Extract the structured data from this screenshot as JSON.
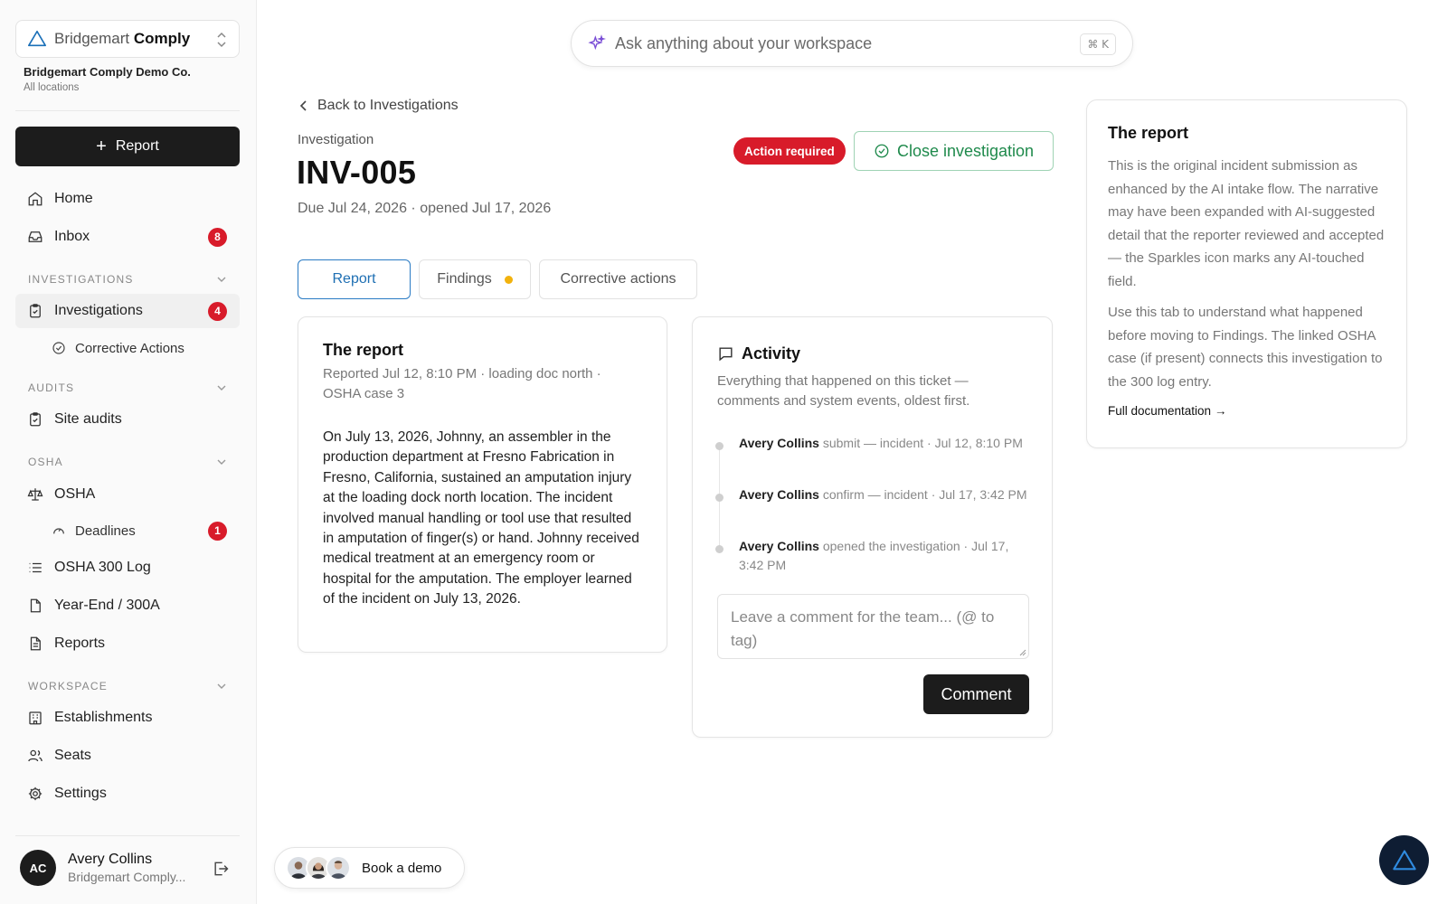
{
  "workspace": {
    "brand_light": "Bridgemart",
    "brand_bold": "Comply",
    "org_name": "Bridgemart Comply Demo Co.",
    "org_location": "All locations"
  },
  "sidebar": {
    "report_button": "Report",
    "home": "Home",
    "inbox": {
      "label": "Inbox",
      "badge": "8"
    },
    "sections": {
      "investigations": "INVESTIGATIONS",
      "audits": "AUDITS",
      "osha": "OSHA",
      "workspace": "WORKSPACE"
    },
    "investigations": {
      "label": "Investigations",
      "badge": "4"
    },
    "corrective_actions": "Corrective Actions",
    "site_audits": "Site audits",
    "osha": "OSHA",
    "deadlines": {
      "label": "Deadlines",
      "badge": "1"
    },
    "osha_300_log": "OSHA 300 Log",
    "year_end": "Year-End / 300A",
    "reports": "Reports",
    "establishments": "Establishments",
    "seats": "Seats",
    "settings": "Settings"
  },
  "user": {
    "initials": "AC",
    "name": "Avery Collins",
    "org": "Bridgemart Comply..."
  },
  "search": {
    "placeholder": "Ask anything about your workspace",
    "shortcut": "⌘ K"
  },
  "investigation": {
    "back_label": "Back to Investigations",
    "label": "Investigation",
    "id": "INV-005",
    "dates": "Due Jul 24, 2026 · opened Jul 17, 2026",
    "status": "Action required",
    "close_button": "Close investigation"
  },
  "tabs": {
    "report": "Report",
    "findings": "Findings",
    "corrective": "Corrective actions"
  },
  "report_card": {
    "title": "The report",
    "meta": "Reported Jul 12, 8:10 PM · loading doc north · OSHA case 3",
    "body": "On July 13, 2026, Johnny, an assembler in the production department at Fresno Fabrication in Fresno, California, sustained an amputation injury at the loading dock north location. The incident involved manual handling or tool use that resulted in amputation of finger(s) or hand. Johnny received medical treatment at an emergency room or hospital for the amputation. The employer learned of the incident on July 13, 2026."
  },
  "activity": {
    "title": "Activity",
    "description": "Everything that happened on this ticket — comments and system events, oldest first.",
    "events": [
      {
        "actor": "Avery Collins",
        "action": "submit — incident",
        "time": "· Jul 12, 8:10 PM"
      },
      {
        "actor": "Avery Collins",
        "action": "confirm — incident",
        "time": "· Jul 17, 3:42 PM"
      },
      {
        "actor": "Avery Collins",
        "action": "opened the investigation",
        "time": "· Jul 17, 3:42 PM"
      }
    ],
    "comment_placeholder": "Leave a comment for the team... (@ to tag)",
    "comment_button": "Comment"
  },
  "help": {
    "title": "The report",
    "p1": "This is the original incident submission as enhanced by the AI intake flow. The narrative may have been expanded with AI-suggested detail that the reporter reviewed and accepted — the Sparkles icon marks any AI-touched field.",
    "p2": "Use this tab to understand what happened before moving to Findings. The linked OSHA case (if present) connects this investigation to the 300 log entry.",
    "link": "Full documentation →"
  },
  "demo": {
    "label": "Book a demo"
  },
  "colors": {
    "accent_blue": "#2a7bc4",
    "danger": "#d81b2a",
    "success": "#1f8a4c",
    "warning_dot": "#f2b20d",
    "dark": "#1c1c1c"
  }
}
